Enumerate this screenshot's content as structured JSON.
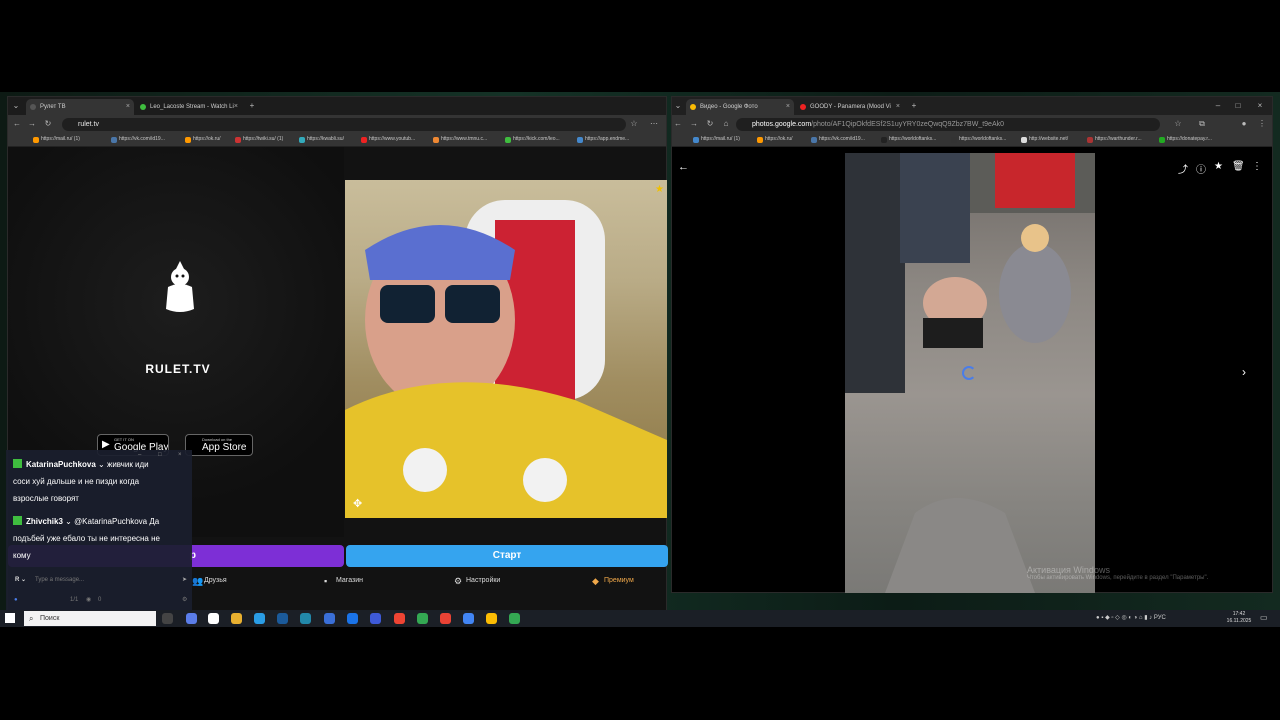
{
  "left_browser": {
    "tabs": [
      {
        "label": "Рулет ТВ",
        "active": true
      },
      {
        "label": "Leo_Lacoste Stream - Watch Li",
        "active": false
      }
    ],
    "address": "rulet.tv",
    "bookmarks": [
      "https://mail.ru/ (1)",
      "https://vk.com/id19...",
      "https://ok.ru/",
      "https://twiki.su/ (1)",
      "https://kwabli.su/",
      "https://www.youtub...",
      "https://www.tmnu.c...",
      "https://kick.com/leo...",
      "https://app.endme..."
    ]
  },
  "rulet": {
    "logo_text": "RULET.TV",
    "google_play_top": "GET IT ON",
    "google_play": "Google Play",
    "app_store_top": "Download on the",
    "app_store": "App Store",
    "start_button": "Старт",
    "purple_button": "p",
    "nav": {
      "friends": "Друзья",
      "shop": "Магазин",
      "settings": "Настройки",
      "premium": "Премиум"
    }
  },
  "chat": {
    "messages": [
      {
        "user": "KatarinaPuchkova",
        "line1": "живчик иди",
        "line2": "соси хуй дальше и не пизди когда",
        "line3": "взрослые говорят"
      },
      {
        "user": "Zhivchik3",
        "line1": "@KatarinaPuchkova Да",
        "line2": "подъбей уже ебало ты не интересна не",
        "line3": "кому"
      }
    ],
    "input_placeholder": "Type a message...",
    "footer_count": "1/1",
    "footer_viewers": "0"
  },
  "right_browser": {
    "tabs": [
      {
        "label": "Видео - Google Фото",
        "active": true
      },
      {
        "label": "GOODY - Panamera (Mood Vi",
        "active": false
      }
    ],
    "address_host": "photos.google.com",
    "address_path": "/photo/AF1QipOkfdESf2S1uyYRY0zeQwqQ9Zbz7BW_t9eAk0",
    "bookmarks": [
      "https://mail.ru/ (1)",
      "https://ok.ru/",
      "https://vk.com/id19...",
      "https://worldoftanks...",
      "https://worldoftanks...",
      "http://website.net/",
      "https://warthunder.r...",
      "https://donatepay.r..."
    ],
    "activate_title": "Активация Windows",
    "activate_sub": "Чтобы активировать Windows, перейдите в раздел \"Параметры\"."
  },
  "taskbar": {
    "search_placeholder": "Поиск",
    "lang": "РУС",
    "time": "17:42",
    "date": "16.11.2025"
  },
  "colors": {
    "start_button": "#35a4ef",
    "purple_button": "#7d2fd6",
    "chat_badge": "#3fbd3f",
    "premium": "#f0a84a"
  }
}
